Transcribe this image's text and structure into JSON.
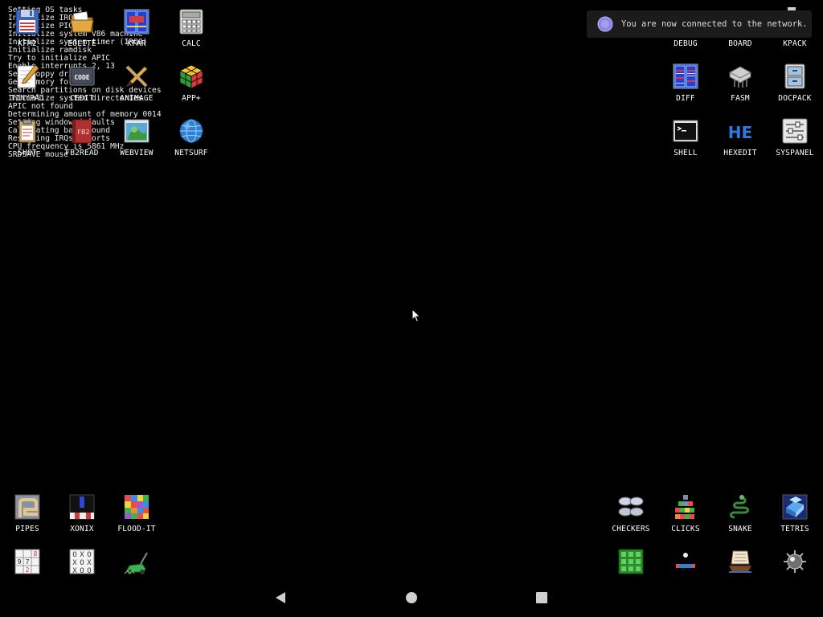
{
  "boot_log": [
    "Setting OS tasks",
    "Initialize IRQ",
    "Initialize PIC",
    "Initialize system V86 machine",
    "Initialize system timer (IRQ0)",
    "Initialize ramdisk",
    "Try to initialize APIC",
    "Enable interrupts 2, 13",
    "Set floppy drives",
    "Get memory for the",
    "Search partitions on disk devices",
    "Initialize system directories",
    "APIC not found",
    "Determining amount of memory 0014",
    "Setting window defaults",
    "Calculating background",
    "Reserving IRQs & ports",
    "CPU frequency is 5861 MHz",
    "SRDSAVE mouse"
  ],
  "desktop": {
    "top_left": [
      {
        "label": "KFM2",
        "icon": "floppy-icon"
      },
      {
        "label": "EOLITE",
        "icon": "folder-icon"
      },
      {
        "label": "KFAR",
        "icon": "kfar-icon"
      },
      {
        "label": "CALC",
        "icon": "calculator-icon"
      },
      {
        "label": "TINYPAD",
        "icon": "notepad-icon"
      },
      {
        "label": "CEDIT",
        "icon": "code-icon"
      },
      {
        "label": "ANIMAGE",
        "icon": "pencil-icon"
      },
      {
        "label": "APP+",
        "icon": "cube-icon"
      },
      {
        "label": "SHOT",
        "icon": "clipboard-icon"
      },
      {
        "label": "FB2READ",
        "icon": "book-icon"
      },
      {
        "label": "WEBVIEW",
        "icon": "webview-icon"
      },
      {
        "label": "NETSURF",
        "icon": "globe-icon"
      }
    ],
    "top_right": [
      {
        "label": "DEBUG"
      },
      {
        "label": "BOARD"
      },
      {
        "label": "KPACK"
      },
      {
        "label": "DIFF",
        "icon": "diff-icon"
      },
      {
        "label": "FASM",
        "icon": "fasm-icon"
      },
      {
        "label": "DOCPACK",
        "icon": "cabinet-icon"
      },
      {
        "label": "SHELL",
        "icon": "terminal-icon"
      },
      {
        "label": "HEXEDIT",
        "icon": "hex-icon"
      },
      {
        "label": "SYSPANEL",
        "icon": "sliders-icon"
      }
    ],
    "bottom_left": [
      {
        "label": "PIPES",
        "icon": "pipes-icon"
      },
      {
        "label": "XONIX",
        "icon": "xonix-icon"
      },
      {
        "label": "FLOOD-IT",
        "icon": "flood-icon"
      },
      {
        "label": "",
        "icon": "sudoku-icon"
      },
      {
        "label": "",
        "icon": "tictactoe-icon"
      },
      {
        "label": "",
        "icon": "mower-icon"
      }
    ],
    "bottom_right": [
      {
        "label": "CHECKERS",
        "icon": "checkers-icon"
      },
      {
        "label": "CLICKS",
        "icon": "clicks-icon"
      },
      {
        "label": "SNAKE",
        "icon": "snake-icon"
      },
      {
        "label": "TETRIS",
        "icon": "tetris-icon"
      },
      {
        "label": "",
        "icon": "grid-game-icon"
      },
      {
        "label": "",
        "icon": "arkanoid-icon"
      },
      {
        "label": "",
        "icon": "ship-icon"
      },
      {
        "label": "",
        "icon": "mine-icon"
      }
    ]
  },
  "toast": {
    "message": "You are now connected to the network."
  },
  "nav": {
    "back": "back-icon",
    "home": "home-icon",
    "recents": "recents-icon"
  }
}
